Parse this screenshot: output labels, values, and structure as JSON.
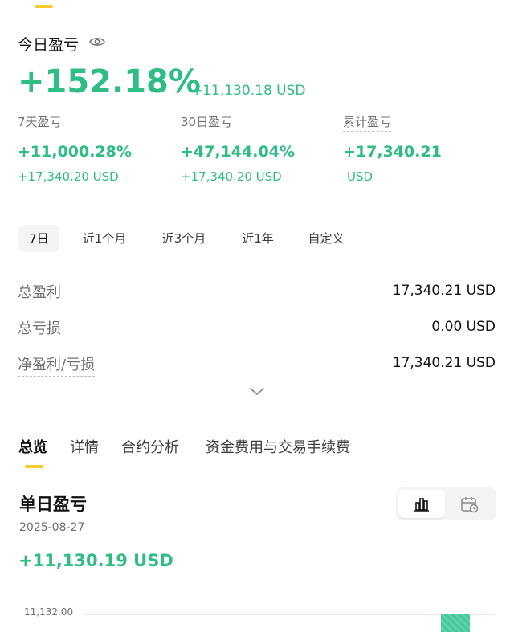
{
  "summary": {
    "title": "今日盈亏",
    "percent": "+152.18%",
    "usd": "+11,130.18 USD",
    "stats": [
      {
        "label": "7天盈亏",
        "value": "+11,000.28%",
        "sub": "+17,340.20 USD"
      },
      {
        "label": "30日盈亏",
        "value": "+47,144.04%",
        "sub": "+17,340.20 USD"
      },
      {
        "label": "累计盈亏",
        "value": "+17,340.21",
        "sub": "USD"
      }
    ]
  },
  "range_tabs": [
    "7日",
    "近1个月",
    "近3个月",
    "近1年",
    "自定义"
  ],
  "pl_rows": [
    {
      "label": "总盈利",
      "value": "17,340.21 USD"
    },
    {
      "label": "总亏损",
      "value": "0.00 USD"
    },
    {
      "label": "净盈利/亏损",
      "value": "17,340.21 USD"
    }
  ],
  "main_tabs": [
    "总览",
    "详情",
    "合约分析",
    "资金费用与交易手续费"
  ],
  "daily": {
    "title": "单日盈亏",
    "date": "2025-08-27",
    "value": "+11,130.19 USD",
    "axis_top": "11,132.00"
  },
  "colors": {
    "positive": "#2ebd85",
    "accent": "#f7cd2e"
  }
}
